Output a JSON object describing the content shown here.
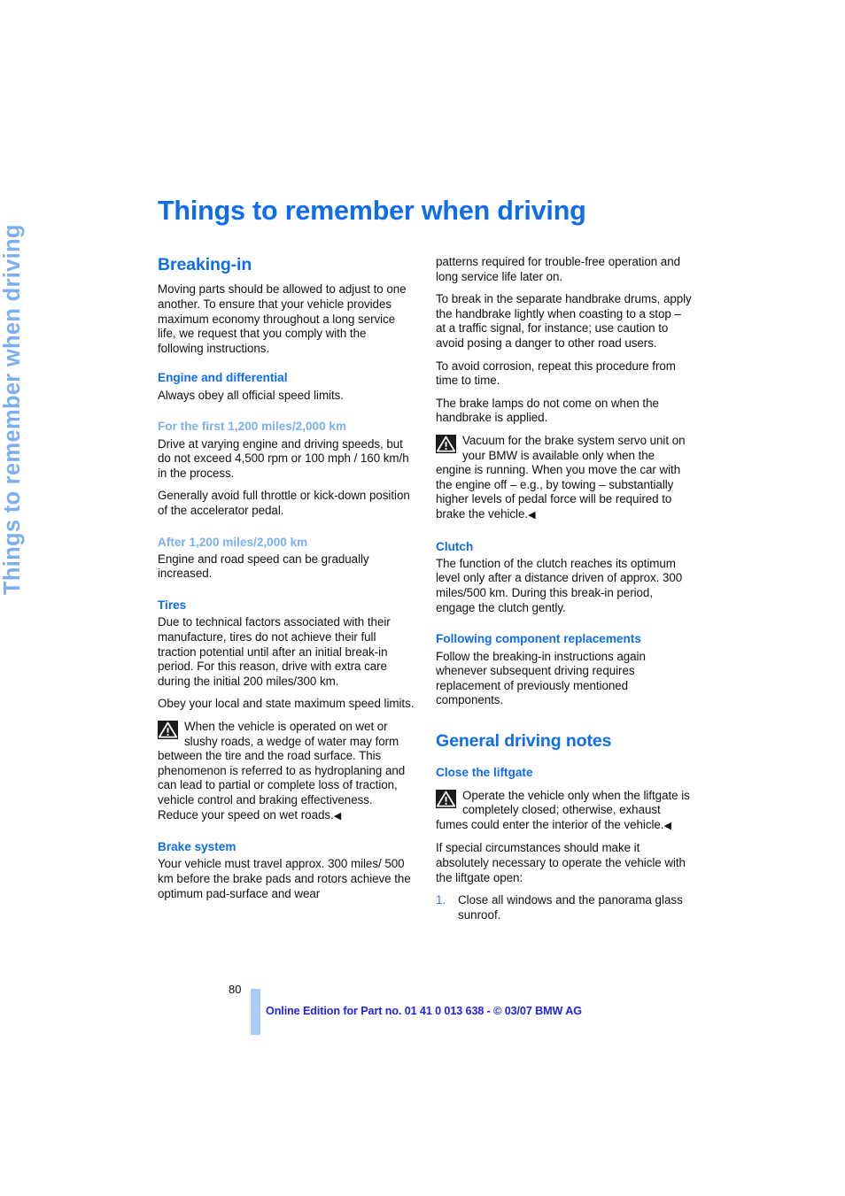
{
  "page": {
    "running_head": "Things to remember when driving",
    "title": "Things to remember when driving",
    "page_number": "80",
    "footer": "Online Edition for Part no. 01 41 0 013 638 - © 03/07 BMW AG",
    "colors": {
      "heading_blue": "#0F6CEE",
      "light_blue": "#7DAEF2",
      "footer_blue": "#2222EE",
      "footer_bar": "#A8CDF5",
      "body_text": "#111111"
    },
    "end_mark": "◀"
  },
  "left_column": {
    "section_title": "Breaking-in",
    "intro": "Moving parts should be allowed to adjust to one another. To ensure that your vehicle provides maximum economy throughout a long service life, we request that you comply with the following instructions.",
    "engine_heading": "Engine and differential",
    "engine_body": "Always obey all official speed limits.",
    "first_miles_heading": "For the first 1,200 miles/2,000 km",
    "first_miles_body_1": "Drive at varying engine and driving speeds, but do not exceed 4,500 rpm or 100 mph / 160 km/h in the process.",
    "first_miles_body_2": "Generally avoid full throttle or kick-down position of the accelerator pedal.",
    "after_miles_heading": "After 1,200 miles/2,000 km",
    "after_miles_body": "Engine and road speed can be gradually increased.",
    "tires_heading": "Tires",
    "tires_body_1": "Due to technical factors associated with their manufacture, tires do not achieve their full traction potential until after an initial break-in period. For this reason, drive with extra care during the initial 200 miles/300 km.",
    "tires_body_2": "Obey your local and state maximum speed limits.",
    "tires_warning": "When the vehicle is operated on wet or slushy roads, a wedge of water may form between the tire and the road surface. This phenomenon is referred to as hydroplaning and can lead to partial or complete loss of traction, vehicle control and braking effectiveness. Reduce your speed on wet roads.",
    "brake_heading": "Brake system",
    "brake_body": "Your vehicle must travel approx. 300 miles/ 500 km before the brake pads and rotors achieve the optimum pad-surface and wear"
  },
  "right_column": {
    "continued_1": "patterns required for trouble-free operation and long service life later on.",
    "continued_2": "To break in the separate handbrake drums, apply the handbrake lightly when coasting to a stop – at a traffic signal, for instance; use caution to avoid posing a danger to other road users.",
    "continued_3": "To avoid corrosion, repeat this procedure from time to time.",
    "continued_4": "The brake lamps do not come on when the handbrake is applied.",
    "brake_warning": "Vacuum for the brake system servo unit on your BMW is available only when the engine is running. When you move the car with the engine off – e.g., by towing – substantially higher levels of pedal force will be required to brake the vehicle.",
    "clutch_heading": "Clutch",
    "clutch_body": "The function of the clutch reaches its optimum level only after a distance driven of approx. 300 miles/500 km. During this break-in period, engage the clutch gently.",
    "following_heading": "Following component replacements",
    "following_body": "Follow the breaking-in instructions again whenever subsequent driving requires replacement of previously mentioned components.",
    "general_heading": "General driving notes",
    "liftgate_heading": "Close the liftgate",
    "liftgate_warning": "Operate the vehicle only when the liftgate is completely closed; otherwise, exhaust fumes could enter the interior of the vehicle.",
    "liftgate_body": "If special circumstances should make it absolutely necessary to operate the vehicle with the liftgate open:",
    "steps": [
      {
        "num": "1.",
        "text": "Close all windows and the panorama glass sunroof."
      }
    ]
  }
}
